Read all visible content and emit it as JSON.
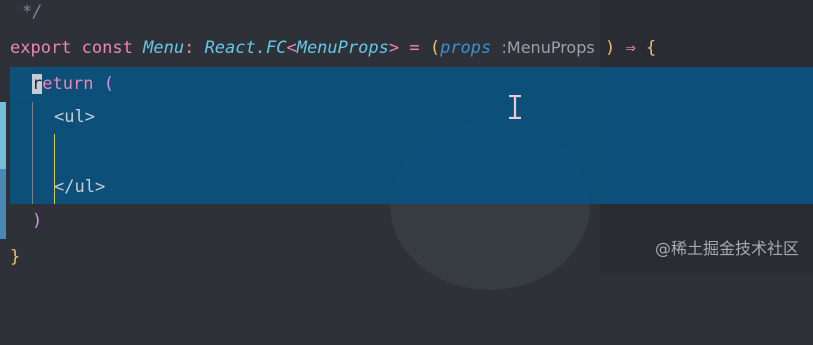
{
  "editor": {
    "lines": {
      "comment": "*/",
      "signature": {
        "export_kw": "export",
        "const_kw": "const",
        "name": "Menu",
        "colon": ":",
        "type_ns": "React.FC",
        "lt": "<",
        "props_type": "MenuProps",
        "gt": ">",
        "equals": "=",
        "open_paren": "(",
        "param": "props",
        "hint_colon": ":",
        "hint_type": "MenuProps",
        "close_paren": ")",
        "arrow": "⇒",
        "open_brace": "{"
      },
      "return_kw_rest": "eturn",
      "return_first_char": "r",
      "return_paren": "(",
      "ul_open": "<ul>",
      "ul_close": "</ul>",
      "close_paren": ")",
      "close_brace": "}"
    }
  },
  "watermark": "@稀土掘金技术社区",
  "colors": {
    "background": "#2e3138",
    "selection": "#0a5280",
    "keyword": "#ec86b2",
    "type": "#64c8e8",
    "bracket_yellow": "#e6c26a",
    "bracket_purple": "#d890ec",
    "param": "#3d8fd0",
    "comment": "#7e8596"
  }
}
